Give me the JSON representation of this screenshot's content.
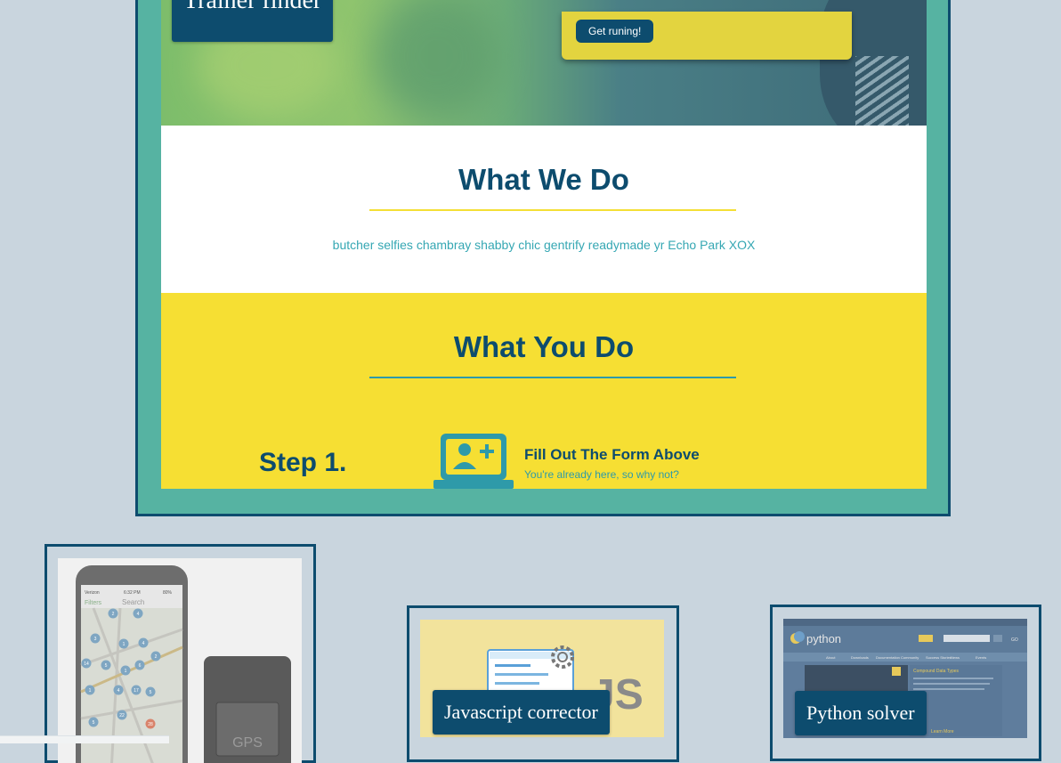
{
  "featured_project": {
    "label": "Trainer finder",
    "hero": {
      "cta_label": "Get runing!"
    },
    "what_we_do": {
      "title": "What We Do",
      "text": "butcher selfies chambray shabby chic gentrify readymade yr Echo Park XOX"
    },
    "what_you_do": {
      "title": "What You Do",
      "step": {
        "label": "Step 1.",
        "icon": "user-add-laptop-icon",
        "title": "Fill Out The Form Above",
        "subtitle": "You're already here, so why not?"
      }
    }
  },
  "projects": [
    {
      "id": "tracker",
      "thumbnail": {
        "icon": "phone-map-gps-icon",
        "phone_status": "Verizon",
        "phone_time": "6:32 PM",
        "phone_battery": "80%",
        "phone_filters": "Filters",
        "phone_search": "Search",
        "device_text": "GPS",
        "pin_labels": [
          "2",
          "4",
          "3",
          "1",
          "4",
          "14",
          "5",
          "1",
          "2",
          "6",
          "1",
          "4",
          "17",
          "5",
          "22",
          "5",
          "28"
        ]
      }
    },
    {
      "id": "javascript",
      "label": "Javascript corrector",
      "thumbnail": {
        "icon": "javascript-laptop-gear-icon",
        "text": "JS"
      }
    },
    {
      "id": "python",
      "label": "Python solver",
      "thumbnail": {
        "icon": "python-logo-icon",
        "logo_text": "python",
        "search_button": "GO",
        "nav": [
          "About",
          "Downloads",
          "Documentation",
          "Community",
          "Success Stories",
          "News",
          "Events"
        ],
        "panel_title": "Compound Data Types",
        "learn_more": "Learn More"
      }
    }
  ],
  "colors": {
    "page_background": "#c9d5de",
    "navy": "#0d4c6e",
    "teal": "#56b3a2",
    "yellow": "#f6df33",
    "cyan_text": "#35a7b3"
  }
}
